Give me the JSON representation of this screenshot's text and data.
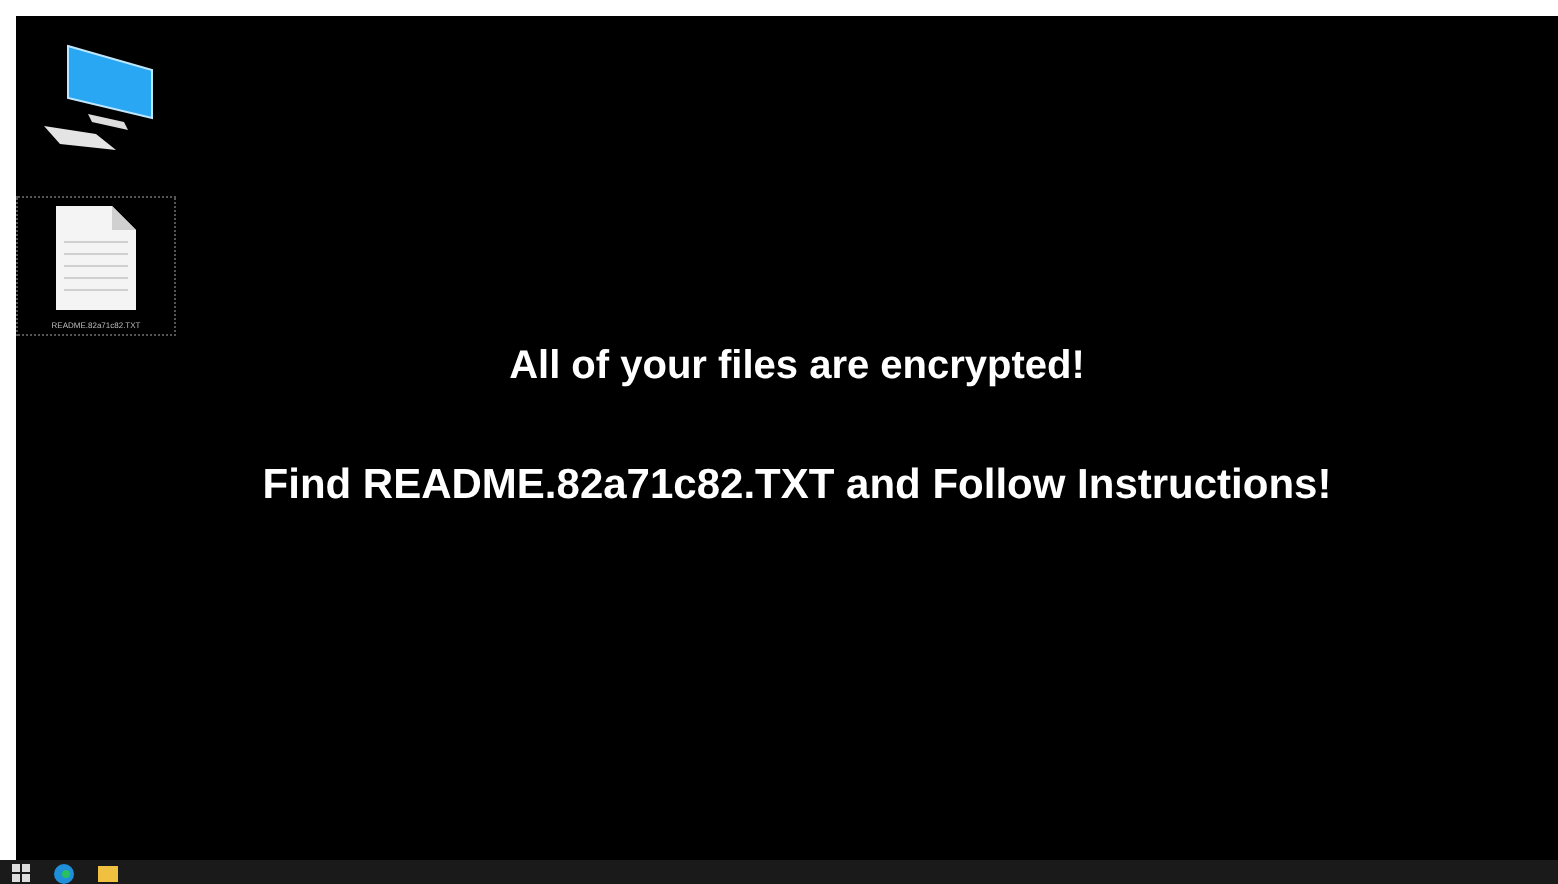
{
  "desktop": {
    "icons": [
      {
        "kind": "computer",
        "selected": false
      },
      {
        "kind": "document",
        "label": "README.82a71c82.TXT",
        "selected": true
      }
    ],
    "message": [
      "All of your files are encrypted!",
      "Find README.82a71c82.TXT and Follow Instructions!"
    ]
  },
  "taskbar": {
    "apps": [
      {
        "kind": "start"
      },
      {
        "kind": "browser"
      },
      {
        "kind": "folder"
      }
    ]
  }
}
